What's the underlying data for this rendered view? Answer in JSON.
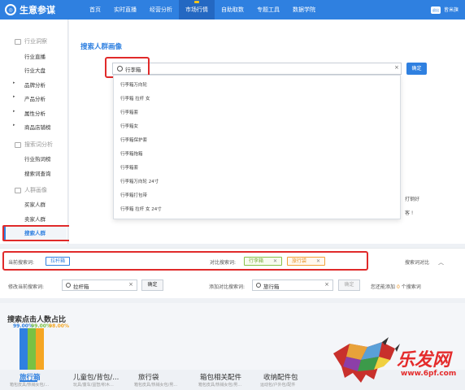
{
  "header": {
    "logo": "生意参谋",
    "nav": [
      "首页",
      "实时直播",
      "经营分析",
      "市场行情",
      "自助取数",
      "专题工具",
      "数据学院"
    ],
    "active_nav": 3,
    "badge": "退出",
    "user": "皆米旗"
  },
  "sidebar": {
    "sections": [
      {
        "label": "行业洞察",
        "items": [
          {
            "label": "行业直播",
            "arrow": false
          },
          {
            "label": "行业大盘",
            "arrow": false
          },
          {
            "label": "品牌分析",
            "arrow": true
          },
          {
            "label": "产品分析",
            "arrow": true
          },
          {
            "label": "属性分析",
            "arrow": true
          },
          {
            "label": "商品店铺榜",
            "arrow": true
          }
        ]
      },
      {
        "label": "搜索词分析",
        "items": [
          {
            "label": "行业热词榜",
            "arrow": false
          },
          {
            "label": "搜索词查询",
            "arrow": false
          }
        ]
      },
      {
        "label": "人群画像",
        "items": [
          {
            "label": "买家人群",
            "arrow": false
          },
          {
            "label": "卖家人群",
            "arrow": false
          },
          {
            "label": "搜索人群",
            "arrow": false
          }
        ]
      }
    ],
    "active_item": "搜索人群"
  },
  "main": {
    "title": "搜索人群画像",
    "search_value": "行李箱",
    "confirm_label": "确定",
    "suggestions": [
      "行李箱万向轮",
      "行李箱 拉杆 女",
      "行李箱套",
      "行李箱女",
      "行李箱保护套",
      "行李箱拖箱",
      "行李箱套",
      "行李箱万向轮 24寸",
      "行李箱打包带",
      "行李箱 拉杆 女 24寸"
    ],
    "side_notes": [
      "打钢好",
      "客 !"
    ]
  },
  "filter": {
    "current_label": "当前搜索词:",
    "current_tag": "拉杆箱",
    "compare_label": "对比搜索词:",
    "compare_tags": [
      "行李箱",
      "旅行袋"
    ],
    "compare_link": "搜索词对比",
    "modify_label": "修改当前搜索词:",
    "modify_value": "拉杆箱",
    "modify_btn": "确定",
    "add_label": "添加对比搜索词:",
    "add_value": "旅行箱",
    "add_btn": "确定",
    "hint_prefix": "您还能添加",
    "hint_count": "0",
    "hint_suffix": "个搜索词"
  },
  "chart_data": {
    "type": "bar",
    "title": "搜索点击人数占比",
    "categories": [
      "拉杆箱",
      "行李箱",
      "旅行袋"
    ],
    "series": [
      {
        "name": "拉杆箱",
        "values": [
          99.0,
          null,
          null
        ]
      },
      {
        "name": "行李箱",
        "values": [
          null,
          99.0,
          null
        ]
      },
      {
        "name": "旅行袋",
        "values": [
          null,
          null,
          98.0
        ]
      }
    ],
    "data_labels": [
      "99.00%",
      "99.00%",
      "98.00%"
    ],
    "colors": [
      "#2f80e0",
      "#7ac143",
      "#f5a623"
    ],
    "legend_tabs": [
      {
        "label": "旅行箱",
        "sub": "箱包皮具/热销女包/..."
      },
      {
        "label": "儿童包/背包/...",
        "sub": "玩具/童车/益智/积木..."
      },
      {
        "label": "旅行袋",
        "sub": "箱包皮具/热销女包/男..."
      },
      {
        "label": "箱包相关配件",
        "sub": "箱包皮具/热销女包/男..."
      },
      {
        "label": "收纳配件包",
        "sub": "运动包/户外包/配件"
      }
    ]
  },
  "watermark": {
    "text": "乐发网",
    "url": "www.6pf.com"
  }
}
